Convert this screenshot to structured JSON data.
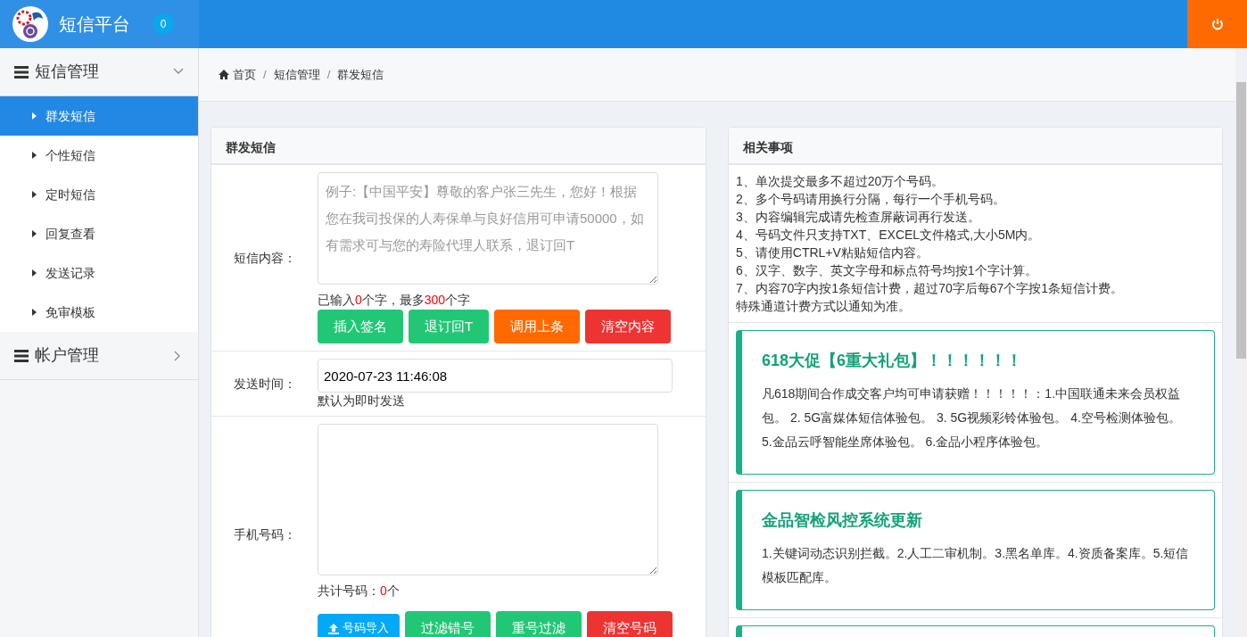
{
  "header": {
    "title": "短信平台",
    "badge": "0"
  },
  "sidebar": {
    "groups": [
      {
        "label": "短信管理",
        "expanded": true,
        "items": [
          {
            "label": "群发短信",
            "selected": true
          },
          {
            "label": "个性短信",
            "selected": false
          },
          {
            "label": "定时短信",
            "selected": false
          },
          {
            "label": "回复查看",
            "selected": false
          },
          {
            "label": "发送记录",
            "selected": false
          },
          {
            "label": "免审模板",
            "selected": false
          }
        ]
      },
      {
        "label": "帐户管理",
        "expanded": false
      }
    ]
  },
  "breadcrumb": {
    "separator": "/",
    "items": [
      "首页",
      "短信管理",
      "群发短信"
    ]
  },
  "send_card": {
    "title": "群发短信",
    "content": {
      "label": "短信内容：",
      "placeholder": "例子:【中国平安】尊敬的客户张三先生，您好！根据您在我司投保的人寿保单与良好信用可申请50000，如有需求可与您的寿险代理人联系，退订回T",
      "counter": {
        "before": "已输入",
        "count": "0",
        "middle": "个字，最多",
        "max": "300",
        "after": "个字"
      },
      "buttons": [
        {
          "label": "插入签名",
          "color": "#22c776"
        },
        {
          "label": "退订回T",
          "color": "#22c776"
        },
        {
          "label": "调用上条",
          "color": "#ff6a00"
        },
        {
          "label": "清空内容",
          "color": "#ee3333"
        }
      ]
    },
    "time": {
      "label": "发送时间：",
      "value": "2020-07-23 11:46:08",
      "hint": "默认为即时发送"
    },
    "numbers": {
      "label": "手机号码：",
      "count": {
        "before": "共计号码：",
        "count": "0",
        "after": "个"
      },
      "buttons": [
        {
          "label": "号码导入",
          "color": "#03a9f4",
          "kind": "upload"
        },
        {
          "label": "过滤错号",
          "color": "#22c776",
          "kind": "plain"
        },
        {
          "label": "重号过滤",
          "color": "#22c776",
          "kind": "plain"
        },
        {
          "label": "清空号码",
          "color": "#ee3333",
          "kind": "plain"
        }
      ]
    }
  },
  "notes_card": {
    "title": "相关事项",
    "lines": [
      "1、单次提交最多不超过20万个号码。",
      "2、多个号码请用换行分隔，每行一个手机号码。",
      "3、内容编辑完成请先检查屏蔽词再行发送。",
      "4、号码文件只支持TXT、EXCEL文件格式,大小5M内。",
      "5、请使用CTRL+V粘贴短信内容。",
      "6、汉字、数字、英文字母和标点符号均按1个字计算。",
      "7、内容70字内按1条短信计费，超过70字后每67个字按1条短信计费。",
      "特殊通道计费方式以通知为准。"
    ],
    "notices": [
      {
        "title": "618大促【6重大礼包】！！！！！！",
        "body": "凡618期间合作成交客户均可申请获赠！！！！！：1.中国联通未来会员权益包。 2. 5G富媒体短信体验包。 3. 5G视频彩铃体验包。 4.空号检测体验包。 5.金品云呼智能坐席体验包。 6.金品小程序体验包。"
      },
      {
        "title": "金品智检风控系统更新",
        "body": "1.关键词动态识别拦截。2.人工二审机制。3.黑名单库。4.资质备案库。5.短信模板匹配库。"
      }
    ]
  }
}
